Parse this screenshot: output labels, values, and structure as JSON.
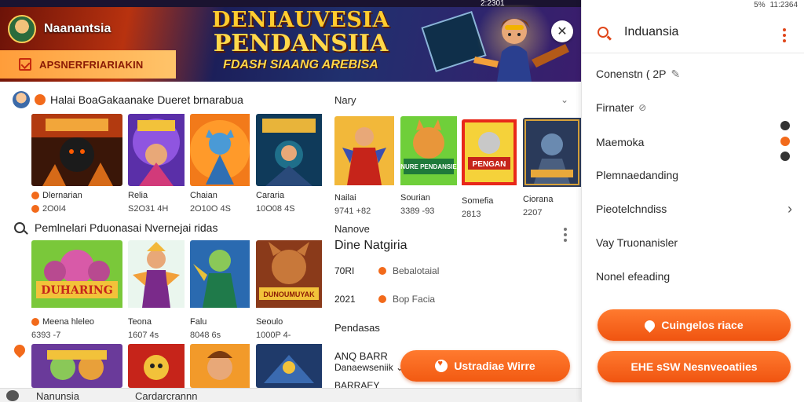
{
  "app": {
    "name": "Naanantsia"
  },
  "banner": {
    "pill_label": "APSNERFRIARIAKIN",
    "promo_line1": "DENIAUVESIA",
    "promo_line2": "PENDANSIIA",
    "promo_line3": "FDASH SIAANG AREBISA",
    "close_glyph": "✕"
  },
  "status_bar": {
    "left_time": "2:2301",
    "right_time": "11:2364",
    "right_text": "5%"
  },
  "section1": {
    "title": "Halai BoaGakaanake Dueret brnarabua",
    "side_label": "Nary"
  },
  "row1": [
    {
      "name": "Dlernarian",
      "meta": "2O0I4"
    },
    {
      "name": "Relia",
      "meta": "S2O31 4H"
    },
    {
      "name": "Chaian",
      "meta": "2O10O 4S"
    },
    {
      "name": "Cararia",
      "meta": "10O08 4S"
    },
    {
      "name": "Nailai",
      "meta": "9741 +82"
    },
    {
      "name": "Sourian",
      "meta": "3389 -93"
    },
    {
      "name": "Somefia",
      "meta": "2813"
    },
    {
      "name": "Ciorana",
      "meta": "2207"
    }
  ],
  "row1_labels": {
    "thumb5": "NURE PENDANSIE",
    "thumb6": "PENGAN"
  },
  "section2": {
    "title": "Pemlnelari Pduonasai Nvernejai ridas",
    "side_label": "Nanove"
  },
  "row2": [
    {
      "name": "Meena hleleo",
      "meta": "6393 -7"
    },
    {
      "name": "Teona",
      "meta": "1607 4s"
    },
    {
      "name": "Falu",
      "meta": "8048 6s"
    },
    {
      "name": "Seoulo",
      "meta": "1000P 4-"
    }
  ],
  "row2_labels": {
    "thumb1": "DUHARING",
    "thumb4": "DUNOUMUYAK"
  },
  "info": {
    "title": "Dine Natgiria",
    "rows": [
      {
        "value": "70RI",
        "tag": "Bebalotaial"
      },
      {
        "value": "2021",
        "tag": "Bop Facia"
      }
    ],
    "label": "Pendasas",
    "line1": "ANQ BARR",
    "line2": "Danaewseniik",
    "line3": "BARRAEY"
  },
  "cta": {
    "label": "Ustradiae Wirre"
  },
  "bottom_bar": {
    "left": "Nanunsia",
    "middle": "Cardarcrannn"
  },
  "panel": {
    "search_text": "Induansia",
    "menu": [
      "Conenstn ( 2P",
      "Firnater",
      "Maemoka",
      "Plemnaedanding",
      "Pieotelchndiss",
      "Vay Truonanisler",
      "Nonel efeading"
    ],
    "button1": "Cuingelos riace",
    "button2": "EHE sSW Nesnveoatiies"
  },
  "colors": {
    "accent": "#f25a12",
    "banner_gold": "#ffcc2f",
    "panel_accent": "#e0461a"
  }
}
